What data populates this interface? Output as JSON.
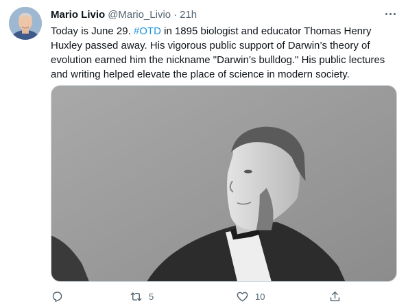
{
  "tweet": {
    "display_name": "Mario Livio",
    "handle": "@Mario_Livio",
    "separator": "·",
    "time": "21h",
    "text_before_hashtag": "Today is June 29. ",
    "hashtag": "#OTD",
    "text_after_hashtag": " in 1895 biologist and educator Thomas Henry Huxley passed away. His vigorous public support of Darwin’s theory of evolution earned him the nickname \"Darwin’s bulldog.\" His public lectures and writing helped elevate the place of science in modern society.",
    "media_alt": "Black and white portrait photograph of Thomas Henry Huxley"
  },
  "actions": {
    "reply_count": "",
    "retweet_count": "5",
    "like_count": "10"
  },
  "icons": {
    "avatar": "profile-photo",
    "more": "more-horizontal-icon",
    "reply": "reply-icon",
    "retweet": "retweet-icon",
    "like": "heart-icon",
    "share": "share-icon"
  },
  "colors": {
    "text": "#0f1419",
    "secondary": "#536471",
    "link": "#1b95e0",
    "border": "#cfd9de"
  }
}
